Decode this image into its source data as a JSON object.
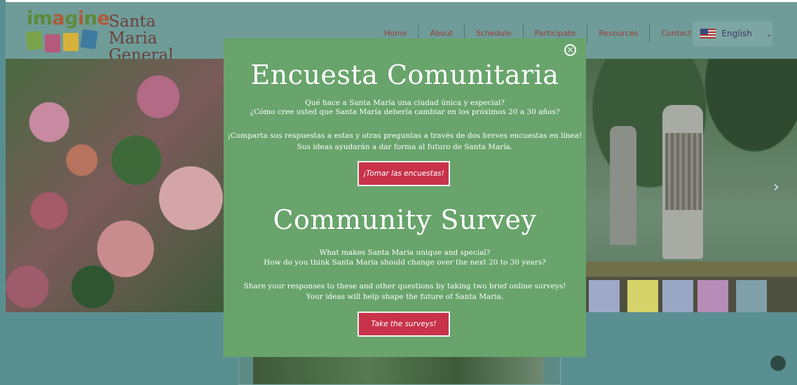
{
  "header": {
    "logo_word": [
      "i",
      "m",
      "a",
      "g",
      "i",
      "n",
      "e"
    ],
    "logo_title_line1": "Santa Maria",
    "logo_title_line2": "General Plan",
    "nav": [
      "Home",
      "About",
      "Schedule",
      "Participate",
      "Resources",
      "Contact"
    ],
    "language": {
      "label": "English",
      "icon": "us-flag-icon"
    }
  },
  "modal": {
    "close_icon": "close-circle-icon",
    "es": {
      "title": "Encuesta Comunitaria",
      "line1": "Qué hace a Santa María una ciudad única y especial?",
      "line2": "¿Cómo cree usted que Santa María debería cambiar en los próximos 20 a 30 años?",
      "line3": "¡Comparta sus respuestas a estas y otras preguntas a través de dos breves encuestas en línea!",
      "line4": "Sus ideas ayudarán a dar forma al futuro de Santa María.",
      "button": "¡Tomar las encuestas!"
    },
    "en": {
      "title": "Community Survey",
      "line1": "What makes Santa Maria unique and special?",
      "line2": "How do you think Santa Maria should change over the next 20 to 30 years?",
      "line3": "Share your responses to these and other questions by taking two brief online surveys!",
      "line4": "Your ideas will help shape the future of Santa Maria.",
      "button": "Take the surveys!"
    }
  },
  "colors": {
    "modal_bg": "#68a46b",
    "button_bg": "#c8324a",
    "overlay": "#5a8f91",
    "nav_text": "#9b3b3b"
  }
}
